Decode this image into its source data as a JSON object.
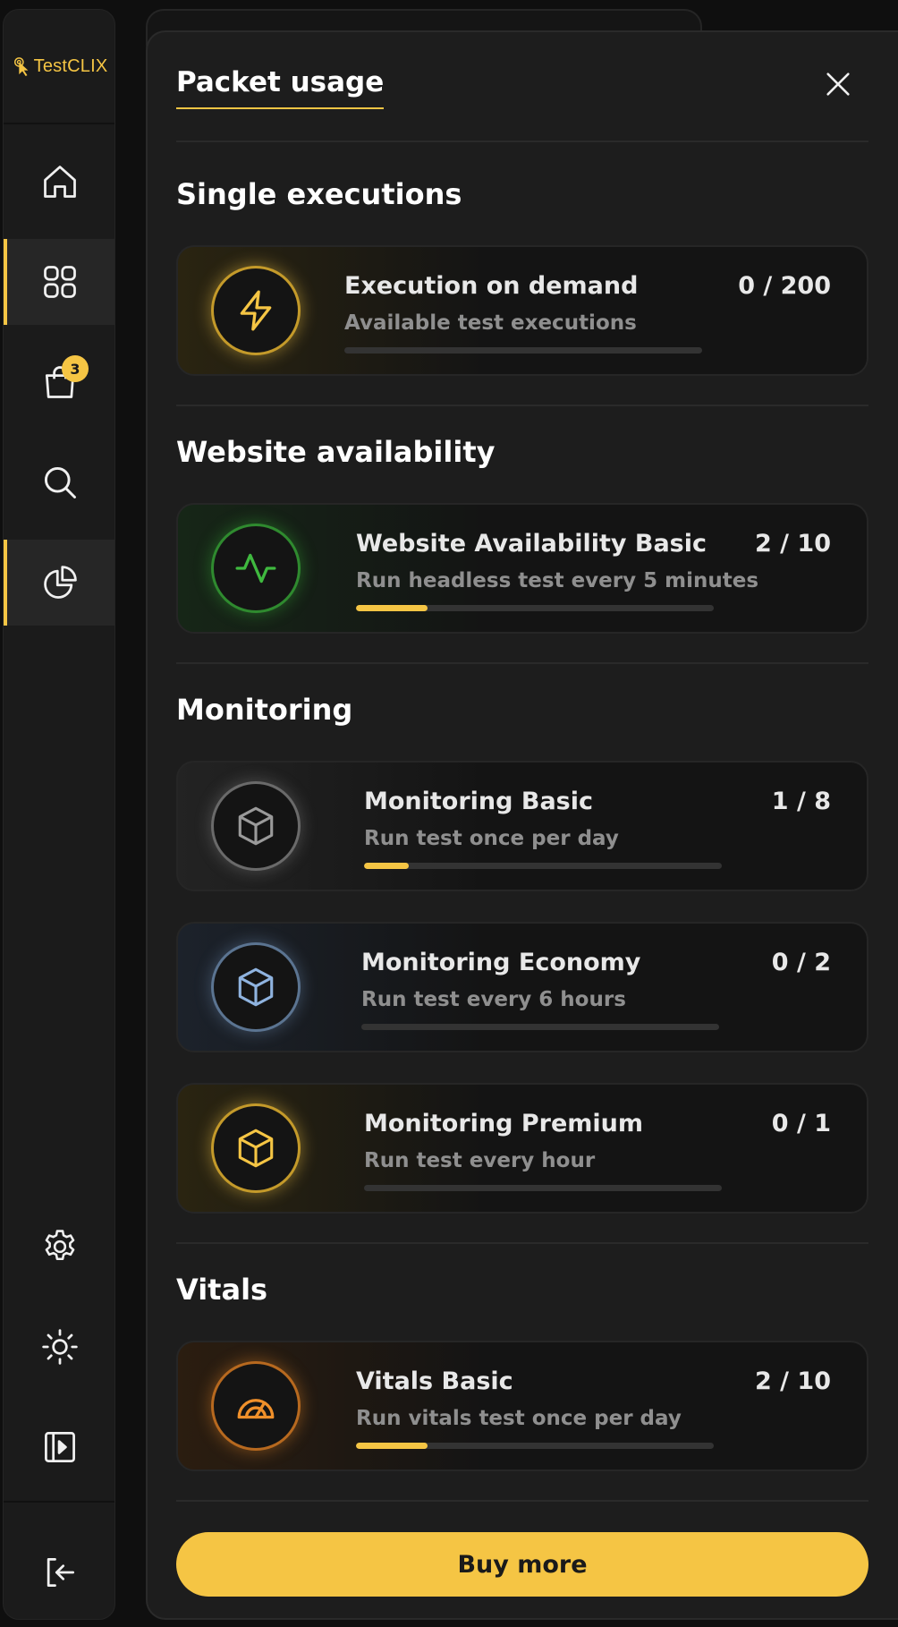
{
  "app": {
    "logo_text": "TestCLIX"
  },
  "sidebar": {
    "cart_badge": "3",
    "items": [
      {
        "id": "home",
        "icon": "home-icon"
      },
      {
        "id": "dashboard",
        "icon": "grid-icon"
      },
      {
        "id": "shop",
        "icon": "shopping-bag-icon"
      },
      {
        "id": "search",
        "icon": "search-icon"
      },
      {
        "id": "usage",
        "icon": "pie-chart-icon"
      },
      {
        "id": "settings",
        "icon": "gear-icon"
      },
      {
        "id": "theme",
        "icon": "sun-icon"
      },
      {
        "id": "collapse",
        "icon": "sidebar-toggle-icon"
      },
      {
        "id": "logout",
        "icon": "logout-icon"
      }
    ]
  },
  "panel": {
    "title": "Packet usage",
    "buy_label": "Buy more",
    "sections": {
      "single": {
        "title": "Single executions",
        "cards": [
          {
            "name": "Execution on demand",
            "desc": "Available test executions",
            "count": "0 / 200",
            "progress": 0,
            "accent": "#f5c544",
            "icon": "lightning-icon"
          }
        ]
      },
      "availability": {
        "title": "Website availability",
        "cards": [
          {
            "name": "Website Availability Basic",
            "desc": "Run headless test every 5 minutes",
            "count": "2 / 10",
            "progress": 0.2,
            "accent": "#3fb93f",
            "icon": "pulse-icon"
          }
        ]
      },
      "monitoring": {
        "title": "Monitoring",
        "cards": [
          {
            "name": "Monitoring Basic",
            "desc": "Run test once per day",
            "count": "1 / 8",
            "progress": 0.125,
            "accent": "#9a9a9a",
            "icon": "cube-icon"
          },
          {
            "name": "Monitoring Economy",
            "desc": "Run test every 6 hours",
            "count": "0 / 2",
            "progress": 0,
            "accent": "#8fb3df",
            "icon": "cube-icon"
          },
          {
            "name": "Monitoring Premium",
            "desc": "Run test every hour",
            "count": "0 / 1",
            "progress": 0,
            "accent": "#f5c544",
            "icon": "cube-icon"
          }
        ]
      },
      "vitals": {
        "title": "Vitals",
        "cards": [
          {
            "name": "Vitals Basic",
            "desc": "Run vitals test once per day",
            "count": "2 / 10",
            "progress": 0.2,
            "accent": "#f0902a",
            "icon": "speedometer-icon"
          }
        ]
      }
    }
  }
}
